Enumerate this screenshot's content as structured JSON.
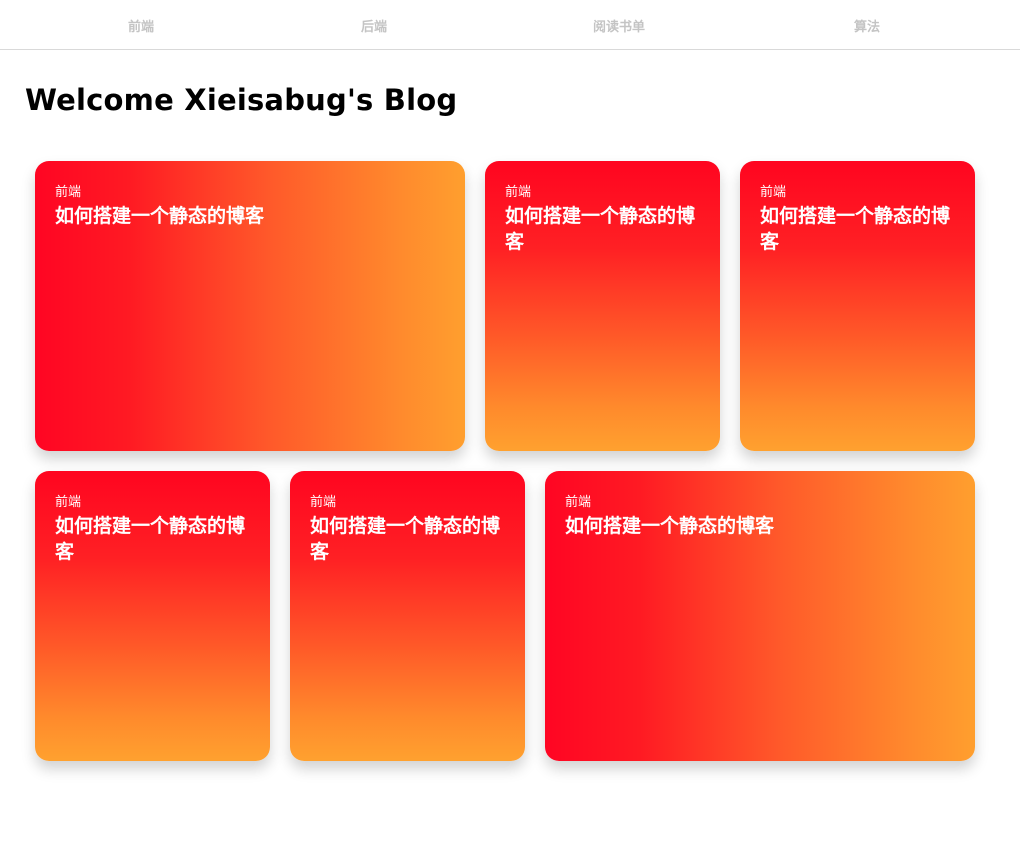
{
  "nav": {
    "items": [
      {
        "label": "前端"
      },
      {
        "label": "后端"
      },
      {
        "label": "阅读书单"
      },
      {
        "label": "算法"
      }
    ]
  },
  "page": {
    "title": "Welcome Xieisabug's Blog"
  },
  "cards": [
    {
      "category": "前端",
      "title": "如何搭建一个静态的博客"
    },
    {
      "category": "前端",
      "title": "如何搭建一个静态的博客"
    },
    {
      "category": "前端",
      "title": "如何搭建一个静态的博客"
    },
    {
      "category": "前端",
      "title": "如何搭建一个静态的博客"
    },
    {
      "category": "前端",
      "title": "如何搭建一个静态的博客"
    },
    {
      "category": "前端",
      "title": "如何搭建一个静态的博客"
    }
  ],
  "colors": {
    "gradient_start": "#ff0523",
    "gradient_end": "#ffa02f",
    "nav_text": "#c4c4c4",
    "title_text": "#000000"
  }
}
